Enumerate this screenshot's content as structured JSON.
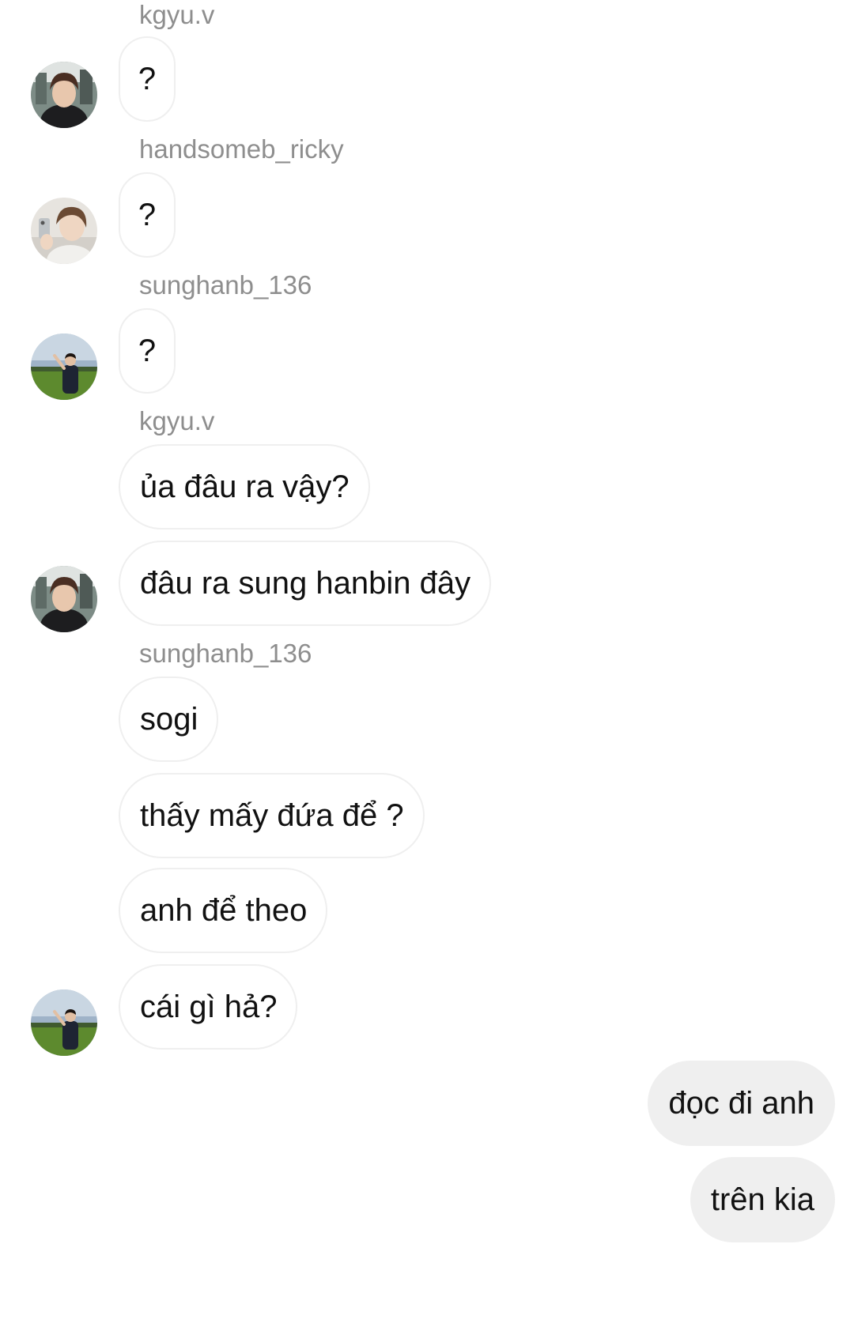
{
  "thread": {
    "senders": {
      "s1": "kgyu.v",
      "s2": "handsomeb_ricky",
      "s3": "sunghanb_136",
      "s4": "kgyu.v",
      "s5": "sunghanb_136"
    },
    "messages": {
      "m1": "?",
      "m2": "?",
      "m3": "?",
      "m4": "ủa đâu ra vậy?",
      "m5": "đâu ra sung hanbin đây",
      "m6": "sogi",
      "m7": "thấy mấy đứa để ?",
      "m8": "anh để theo",
      "m9": "cái gì hả?",
      "m10": "đọc đi anh",
      "m11": "trên kia"
    }
  }
}
